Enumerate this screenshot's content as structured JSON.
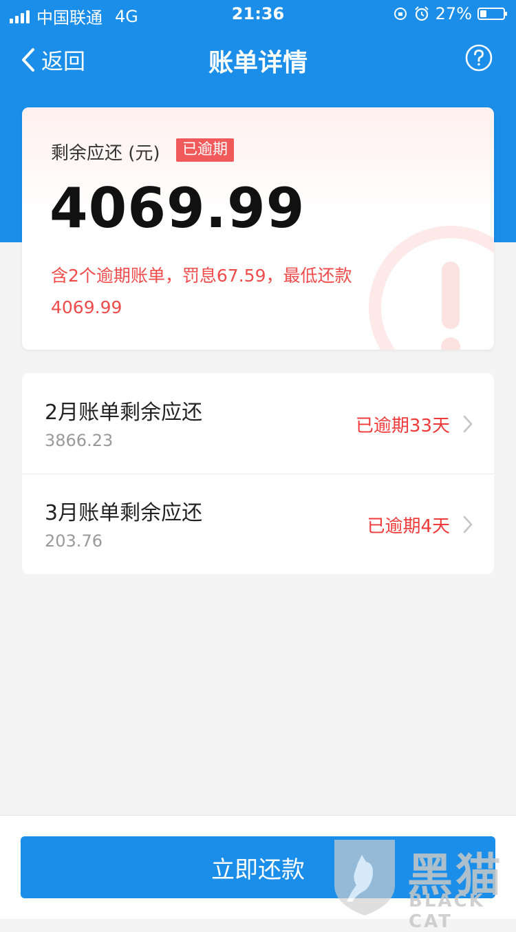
{
  "status_bar": {
    "carrier": "中国联通",
    "network": "4G",
    "time": "21:36",
    "battery": "27%",
    "battery_level": 0.27
  },
  "nav": {
    "back_label": "返回",
    "title": "账单详情",
    "help_icon": "question-circle-icon"
  },
  "summary": {
    "label": "剩余应还 (元)",
    "tag": "已逾期",
    "amount": "4069.99",
    "note": "含2个逾期账单，罚息67.59，最低还款4069.99"
  },
  "bills": [
    {
      "title": "2月账单剩余应还",
      "amount": "3866.23",
      "status": "已逾期33天"
    },
    {
      "title": "3月账单剩余应还",
      "amount": "203.76",
      "status": "已逾期4天"
    }
  ],
  "action": {
    "pay_label": "立即还款"
  },
  "watermark": {
    "cn": "黑猫",
    "en": "BLACK CAT"
  },
  "colors": {
    "primary": "#1a8ee8",
    "overdue": "#f03a3a",
    "tag": "#f05a5a",
    "background": "#f4f4f4"
  }
}
